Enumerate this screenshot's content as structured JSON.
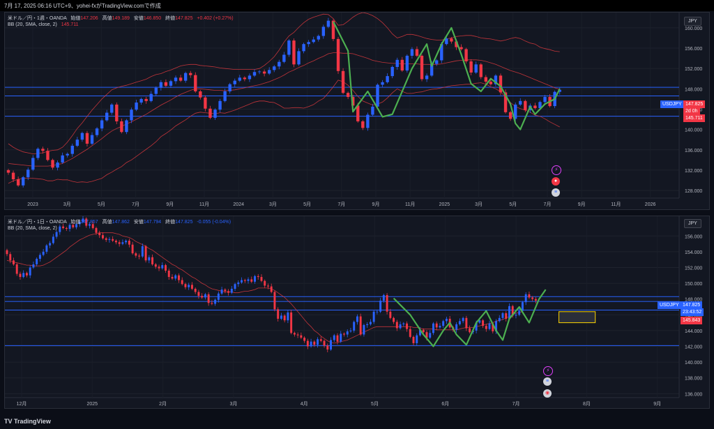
{
  "header": {
    "text": "7月 17, 2025 06:16 UTC+9、yohei-fxがTradingView.comで作成"
  },
  "colors": {
    "up": "#2962ff",
    "down": "#f23645",
    "bb": "#e03a3e",
    "pattern": "#4caf50",
    "hline": "#2962ff",
    "zone": "#ffd600"
  },
  "pane1": {
    "symbol": "米ドル／円・1週・OANDA",
    "o_label": "始値",
    "o": "147.206",
    "h_label": "高値",
    "h": "149.189",
    "l_label": "安値",
    "l": "146.850",
    "c_label": "終値",
    "c": "147.825",
    "change": "+0.402 (+0.27%)",
    "bb_label": "BB (20, SMA, close, 2)",
    "bb_value": "145.711",
    "currency": "JPY",
    "price_ticks": [
      "160.000",
      "156.000",
      "152.000",
      "148.000",
      "144.000",
      "140.000",
      "136.000",
      "132.000",
      "128.000"
    ],
    "time_ticks": [
      "2023",
      "3月",
      "5月",
      "7月",
      "9月",
      "11月",
      "2024",
      "3月",
      "5月",
      "7月",
      "9月",
      "11月",
      "2025",
      "3月",
      "5月",
      "7月",
      "9月",
      "11月",
      "2026"
    ],
    "tag_symbol": "USDJPY",
    "tag_price": "147.825",
    "tag_countdown": "2d 0h",
    "tag_bb": "145.711",
    "chart_data": {
      "type": "candlestick",
      "interval": "1W",
      "ylim": [
        126.5,
        163
      ],
      "close": [
        131.5,
        130.2,
        129.0,
        130.6,
        132.1,
        134.4,
        136.2,
        135.8,
        134.0,
        132.5,
        133.5,
        134.9,
        135.2,
        136.8,
        138.0,
        139.3,
        137.2,
        138.9,
        140.2,
        141.8,
        143.3,
        144.9,
        141.6,
        139.5,
        141.8,
        143.9,
        145.3,
        146.0,
        145.6,
        147.0,
        148.2,
        149.3,
        148.6,
        149.5,
        150.2,
        149.6,
        151.1,
        150.7,
        147.5,
        146.3,
        144.1,
        142.3,
        143.9,
        145.6,
        147.5,
        148.9,
        149.6,
        150.2,
        149.9,
        150.6,
        151.3,
        151.4,
        151.0,
        151.7,
        152.4,
        153.3,
        154.7,
        157.5,
        152.8,
        155.4,
        156.8,
        157.2,
        157.7,
        158.4,
        160.2,
        161.4,
        157.8,
        151.5,
        147.2,
        146.4,
        144.7,
        141.6,
        140.3,
        142.9,
        144.5,
        148.8,
        149.3,
        150.5,
        152.3,
        153.7,
        151.6,
        154.5,
        155.8,
        154.5,
        149.9,
        150.6,
        152.9,
        153.6,
        156.8,
        157.9,
        157.3,
        156.2,
        155.8,
        153.4,
        151.2,
        152.8,
        150.3,
        149.4,
        148.9,
        150.6,
        147.3,
        143.4,
        142.1,
        144.9,
        145.6,
        143.8,
        144.7,
        144.2,
        145.4,
        146.4,
        144.6,
        147.4,
        147.8
      ],
      "upper": [
        137.2,
        136.5,
        136.0,
        135.6,
        135.4,
        135.2,
        135.3,
        135.4,
        135.7,
        135.9,
        136.0,
        136.5,
        137.5,
        138.8,
        140.2,
        141.3,
        142.6,
        143.8,
        144.9,
        146.0,
        146.9,
        147.8,
        148.2,
        148.5,
        148.7,
        149.0,
        149.3,
        149.6,
        149.9,
        150.4,
        150.8,
        151.0,
        151.4,
        151.7,
        152.1,
        152.5,
        152.7,
        152.8,
        152.8,
        152.6,
        152.5,
        152.4,
        152.3,
        152.1,
        152.0,
        151.9,
        151.8,
        151.8,
        151.8,
        151.8,
        151.8,
        152.0,
        152.6,
        153.4,
        154.3,
        155.6,
        157.2,
        158.4,
        159.1,
        160.1,
        161.0,
        161.7,
        162.1,
        162.4,
        162.7,
        162.6,
        161.8,
        160.5,
        160.6,
        161.3,
        162.1,
        162.7,
        163.0,
        162.8,
        162.4,
        161.8,
        161.0,
        160.0,
        158.8,
        158.0,
        158.3,
        158.7,
        158.7,
        158.5,
        158.2,
        157.9,
        157.7,
        157.6,
        157.6,
        157.8,
        158.0,
        158.3,
        158.4,
        158.5,
        158.5,
        158.3,
        158.0,
        157.9,
        157.8,
        157.6,
        157.4,
        157.6,
        157.9,
        158.1,
        157.9,
        157.4,
        157.0,
        156.8,
        156.2,
        155.9,
        155.7,
        155.4,
        155.3
      ],
      "middle": [
        133.3,
        133.2,
        133.1,
        133.0,
        132.9,
        132.8,
        132.8,
        132.8,
        132.8,
        132.9,
        133.1,
        133.3,
        133.8,
        134.3,
        134.9,
        135.5,
        136.1,
        136.8,
        137.5,
        138.2,
        139.0,
        139.7,
        140.2,
        140.6,
        141.1,
        141.5,
        142.0,
        142.5,
        143.0,
        143.6,
        144.2,
        144.8,
        145.3,
        145.8,
        146.4,
        146.9,
        147.3,
        147.7,
        148.0,
        148.0,
        147.9,
        147.8,
        147.7,
        147.7,
        147.6,
        147.7,
        147.8,
        148.0,
        148.2,
        148.4,
        148.6,
        148.8,
        149.1,
        149.4,
        149.8,
        150.2,
        150.7,
        151.3,
        151.7,
        152.2,
        152.6,
        153.1,
        153.5,
        154.0,
        154.4,
        154.9,
        155.1,
        155.1,
        155.0,
        155.0,
        154.9,
        154.6,
        154.3,
        154.0,
        153.6,
        153.4,
        153.2,
        153.1,
        153.0,
        153.0,
        152.9,
        152.9,
        152.9,
        152.9,
        152.8,
        152.8,
        152.8,
        152.8,
        152.9,
        153.1,
        153.3,
        153.5,
        153.6,
        153.7,
        153.7,
        153.7,
        153.6,
        153.4,
        153.1,
        152.8,
        152.4,
        152.0,
        151.6,
        151.3,
        151.0,
        150.6,
        150.2,
        149.8,
        149.4,
        149.0,
        148.6,
        148.2,
        147.9
      ],
      "lower": [
        129.4,
        129.9,
        130.2,
        130.4,
        130.4,
        130.4,
        130.3,
        130.2,
        129.9,
        129.9,
        130.2,
        130.1,
        130.1,
        129.8,
        129.6,
        129.7,
        129.6,
        129.8,
        130.1,
        130.4,
        131.1,
        131.6,
        132.2,
        132.7,
        133.5,
        134.0,
        134.7,
        135.4,
        136.1,
        136.8,
        137.6,
        138.6,
        139.2,
        139.9,
        140.7,
        141.3,
        141.9,
        142.6,
        143.2,
        143.4,
        143.3,
        143.2,
        143.1,
        143.3,
        143.2,
        143.5,
        143.8,
        144.2,
        144.6,
        145.0,
        145.4,
        145.6,
        145.6,
        145.4,
        145.3,
        144.8,
        144.2,
        144.2,
        144.3,
        144.3,
        144.2,
        144.5,
        144.9,
        145.6,
        146.1,
        147.2,
        148.4,
        149.7,
        149.4,
        148.7,
        147.7,
        146.5,
        145.6,
        145.2,
        144.8,
        145.0,
        145.4,
        146.2,
        147.2,
        148.0,
        147.5,
        147.1,
        147.1,
        147.3,
        147.4,
        147.7,
        147.9,
        148.0,
        148.2,
        148.4,
        148.6,
        148.7,
        148.8,
        148.9,
        148.9,
        149.1,
        149.2,
        148.9,
        148.4,
        148.0,
        147.4,
        146.4,
        145.3,
        144.5,
        144.1,
        143.8,
        143.4,
        142.8,
        142.6,
        142.1,
        141.5,
        141.0,
        140.5
      ]
    }
  },
  "pane2": {
    "symbol": "米ドル／円・1日・OANDA",
    "o_label": "始値",
    "o": "147.857",
    "h_label": "高値",
    "h": "147.862",
    "l_label": "安値",
    "l": "147.794",
    "c_label": "終値",
    "c": "147.825",
    "change": "-0.055 (-0.04%)",
    "bb_label": "BB (20, SMA, close, 2)",
    "currency": "JPY",
    "price_ticks": [
      "156.000",
      "154.000",
      "152.000",
      "150.000",
      "148.000",
      "146.000",
      "144.000",
      "142.000",
      "140.000",
      "138.000",
      "136.000"
    ],
    "time_ticks": [
      "12月",
      "2025",
      "2月",
      "3月",
      "4月",
      "5月",
      "6月",
      "7月",
      "8月",
      "9月"
    ],
    "tag_symbol": "USDJPY",
    "tag_price": "147.825",
    "tag_countdown": "23:43:52",
    "tag_bb": "145.843",
    "chart_data": {
      "type": "candlestick",
      "interval": "1D",
      "ylim": [
        135.5,
        158.5
      ],
      "close": [
        153.7,
        152.9,
        152.4,
        151.2,
        150.8,
        151.3,
        151.0,
        152.0,
        152.4,
        153.1,
        153.6,
        154.0,
        154.8,
        155.1,
        155.9,
        156.5,
        157.2,
        157.0,
        156.9,
        157.4,
        157.1,
        157.5,
        157.8,
        158.2,
        157.3,
        157.5,
        157.0,
        156.4,
        156.1,
        155.7,
        155.5,
        155.6,
        155.4,
        155.2,
        155.0,
        155.2,
        155.4,
        154.9,
        153.8,
        153.5,
        153.4,
        154.7,
        152.9,
        153.3,
        152.4,
        152.1,
        151.9,
        152.3,
        151.6,
        150.8,
        150.6,
        151.0,
        150.4,
        149.9,
        149.5,
        149.8,
        149.3,
        148.9,
        148.4,
        148.2,
        148.6,
        147.5,
        147.4,
        147.9,
        148.7,
        149.2,
        149.0,
        148.8,
        149.3,
        149.9,
        150.1,
        150.4,
        150.3,
        150.5,
        150.2,
        150.9,
        150.8,
        150.3,
        149.7,
        149.6,
        148.9,
        146.7,
        145.5,
        145.9,
        145.3,
        146.3,
        143.7,
        143.5,
        143.4,
        143.1,
        142.7,
        142.0,
        142.6,
        142.2,
        142.9,
        142.7,
        142.1,
        141.6,
        142.8,
        143.4,
        142.6,
        143.6,
        143.5,
        143.9,
        144.0,
        145.1,
        145.8,
        143.5,
        144.7,
        144.8,
        145.1,
        146.4,
        146.4,
        147.8,
        148.5,
        146.4,
        145.6,
        145.1,
        144.3,
        144.8,
        144.9,
        144.2,
        143.2,
        142.4,
        143.4,
        144.1,
        143.8,
        143.1,
        143.7,
        144.9,
        144.4,
        144.6,
        145.2,
        145.5,
        144.4,
        144.1,
        144.8,
        145.2,
        145.6,
        144.3,
        143.8,
        144.0,
        145.0,
        145.3,
        144.6,
        144.2,
        144.9,
        143.9,
        145.2,
        145.6,
        146.2,
        145.5,
        147.1,
        145.9,
        146.0,
        146.5,
        147.6,
        148.6,
        148.2,
        148.0,
        147.8
      ],
      "middle": [
        152.9,
        152.8,
        152.7,
        152.6,
        152.5,
        152.4,
        152.3,
        152.3,
        152.2,
        152.2,
        152.2,
        152.3,
        152.5,
        152.7,
        153.0,
        153.3,
        153.6,
        153.9,
        154.2,
        154.6,
        154.9,
        155.2,
        155.5,
        155.7,
        155.9,
        156.1,
        156.2,
        156.3,
        156.4,
        156.4,
        156.4,
        156.4,
        156.4,
        156.3,
        156.2,
        156.0,
        155.9,
        155.8,
        155.6,
        155.3,
        155.1,
        154.9,
        154.7,
        154.4,
        154.2,
        153.9,
        153.6,
        153.3,
        153.0,
        152.7,
        152.4,
        152.2,
        151.9,
        151.7,
        151.4,
        151.1,
        150.8,
        150.6,
        150.3,
        150.0,
        149.8,
        149.5,
        149.3,
        149.2,
        149.1,
        149.0,
        148.9,
        148.9,
        148.9,
        148.8,
        148.8,
        148.9,
        149.0,
        149.0,
        149.1,
        149.2,
        149.4,
        149.4,
        149.4,
        149.4,
        149.3,
        149.1,
        148.8,
        148.5,
        148.2,
        147.8,
        147.4,
        146.9,
        146.4,
        145.9,
        145.4,
        144.9,
        144.5,
        144.0,
        143.7,
        143.3,
        143.0,
        142.7,
        142.5,
        142.4,
        142.5,
        142.6,
        142.7,
        142.8,
        143.0,
        143.2,
        143.4,
        143.6,
        143.8,
        144.0,
        144.2,
        144.4,
        144.5,
        144.5,
        144.5,
        144.5,
        144.5,
        144.5,
        144.5,
        144.5,
        144.5,
        144.5,
        144.5,
        144.4,
        144.4,
        144.3,
        144.2,
        144.2,
        144.2,
        144.2,
        144.1,
        144.1,
        144.1,
        144.1,
        144.1,
        144.1,
        144.1,
        144.2,
        144.3,
        144.4,
        144.4,
        144.4,
        144.5,
        144.6,
        144.7,
        144.8,
        144.9,
        145.0,
        145.2,
        145.3,
        145.4,
        145.6,
        145.8,
        146.0,
        146.2,
        146.3,
        146.4
      ]
    }
  }
}
